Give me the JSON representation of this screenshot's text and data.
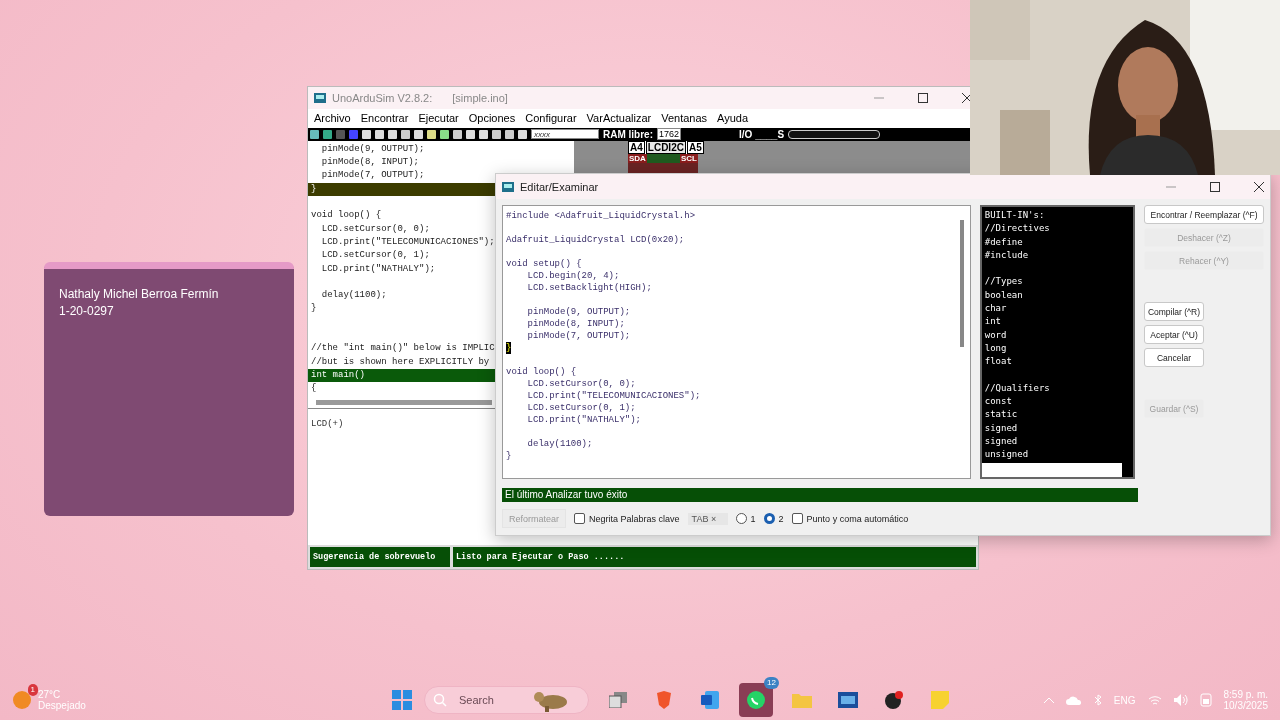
{
  "student_card": {
    "name": "Nathaly Michel Berroa Fermín",
    "id": "1-20-0297"
  },
  "main_window": {
    "app_title": "UnoArduSim V2.8.2:",
    "file": "[simple.ino]",
    "menu": [
      "Archivo",
      "Encontrar",
      "Ejecutar",
      "Opciones",
      "Configurar",
      "VarActualizar",
      "Ventanas",
      "Ayuda"
    ],
    "toolbar": {
      "search_value": "xxxx",
      "ram_label": "RAM libre:",
      "ram_value": "1762",
      "io_label": "I/O ____S"
    },
    "lcd_module": {
      "left_pin": "A4",
      "title": "LCDI2C",
      "right_pin": "A5",
      "sda": "SDA",
      "scl": "SCL"
    },
    "code_lines": [
      {
        "kind": "code",
        "text": "  pinMode(9, OUTPUT);"
      },
      {
        "kind": "code",
        "text": "  pinMode(8, INPUT);"
      },
      {
        "kind": "code",
        "text": "  pinMode(7, OUTPUT);"
      },
      {
        "kind": "current",
        "text": "}"
      },
      {
        "kind": "blank"
      },
      {
        "kind": "code",
        "text": "void loop() {"
      },
      {
        "kind": "code",
        "text": "  LCD.setCursor(0, 0);"
      },
      {
        "kind": "code",
        "text": "  LCD.print(\"TELECOMUNICACIONES\");"
      },
      {
        "kind": "code",
        "text": "  LCD.setCursor(0, 1);"
      },
      {
        "kind": "code",
        "text": "  LCD.print(\"NATHALY\");"
      },
      {
        "kind": "blank"
      },
      {
        "kind": "code",
        "text": "  delay(1100);"
      },
      {
        "kind": "code",
        "text": "}"
      },
      {
        "kind": "blank"
      },
      {
        "kind": "blank"
      },
      {
        "kind": "code",
        "text": "//the \"int main()\" below is IMPLIC"
      },
      {
        "kind": "code",
        "text": "//but is shown here EXPLICITLY by"
      },
      {
        "kind": "active",
        "text": "int main()"
      },
      {
        "kind": "code",
        "text": "{"
      }
    ],
    "lower_pane_text": "LCD(+)",
    "status": [
      "Sugerencia de sobrevuelo",
      "Listo para Ejecutar o Paso ......"
    ]
  },
  "dialog": {
    "title": "Editar/Examinar",
    "code_lines": [
      {
        "kind": "code",
        "text": "#include <Adafruit_LiquidCrystal.h>"
      },
      {
        "kind": "blank"
      },
      {
        "kind": "code",
        "text": "Adafruit_LiquidCrystal LCD(0x20);"
      },
      {
        "kind": "blank"
      },
      {
        "kind": "code",
        "text": "void setup() {"
      },
      {
        "kind": "code",
        "text": "    LCD.begin(20, 4);"
      },
      {
        "kind": "code",
        "text": "    LCD.setBacklight(HIGH);"
      },
      {
        "kind": "blank"
      },
      {
        "kind": "code",
        "text": "    pinMode(9, OUTPUT);"
      },
      {
        "kind": "code",
        "text": "    pinMode(8, INPUT);"
      },
      {
        "kind": "code",
        "text": "    pinMode(7, OUTPUT);"
      },
      {
        "kind": "cursor",
        "text": "}"
      },
      {
        "kind": "blank"
      },
      {
        "kind": "code",
        "text": "void loop() {"
      },
      {
        "kind": "code",
        "text": "    LCD.setCursor(0, 0);"
      },
      {
        "kind": "code",
        "text": "    LCD.print(\"TELECOMUNICACIONES\");"
      },
      {
        "kind": "code",
        "text": "    LCD.setCursor(0, 1);"
      },
      {
        "kind": "code",
        "text": "    LCD.print(\"NATHALY\");"
      },
      {
        "kind": "blank"
      },
      {
        "kind": "code",
        "text": "    delay(1100);"
      },
      {
        "kind": "code",
        "text": "}"
      }
    ],
    "builtins": [
      {
        "kind": "item",
        "text": "BUILT-IN's:"
      },
      {
        "kind": "item",
        "text": "//Directives"
      },
      {
        "kind": "item",
        "text": "#define"
      },
      {
        "kind": "item",
        "text": "#include"
      },
      {
        "kind": "blank"
      },
      {
        "kind": "item",
        "text": "//Types"
      },
      {
        "kind": "item",
        "text": "boolean"
      },
      {
        "kind": "item",
        "text": "char"
      },
      {
        "kind": "item",
        "text": "int"
      },
      {
        "kind": "item",
        "text": "word"
      },
      {
        "kind": "item",
        "text": "long"
      },
      {
        "kind": "item",
        "text": "float"
      },
      {
        "kind": "blank"
      },
      {
        "kind": "item",
        "text": "//Qualifiers"
      },
      {
        "kind": "item",
        "text": "const"
      },
      {
        "kind": "item",
        "text": "static"
      },
      {
        "kind": "item",
        "text": "signed"
      },
      {
        "kind": "item",
        "text": "signed"
      },
      {
        "kind": "item",
        "text": "unsigned"
      }
    ],
    "button_groups": [
      [
        {
          "label": "Encontrar / Reemplazar (^F)",
          "disabled": false
        },
        {
          "label": "Deshacer (^Z)",
          "disabled": true
        },
        {
          "label": "Rehacer (^Y)",
          "disabled": true
        }
      ],
      [
        {
          "label": "Compilar (^R)",
          "disabled": false
        },
        {
          "label": "Aceptar (^U)",
          "disabled": false
        },
        {
          "label": "Cancelar",
          "disabled": false
        }
      ],
      [
        {
          "label": "Guardar (^S)",
          "disabled": true
        }
      ]
    ],
    "status": "El último Analizar tuvo éxito",
    "reformat": {
      "label": "Reformatear",
      "disabled": true
    },
    "bold_keywords": {
      "label": "Negrita Palabras clave",
      "checked": false
    },
    "tab_field": "TAB ×",
    "radios": [
      {
        "label": "1",
        "selected": false
      },
      {
        "label": "2",
        "selected": true
      }
    ],
    "auto_semicolon": {
      "label": "Punto y coma automático",
      "checked": false
    }
  },
  "taskbar": {
    "weather_badge": "1",
    "temperature": "27°C",
    "condition": "Despejado",
    "search_placeholder": "Search",
    "chat_badge": "12",
    "language": "ENG",
    "time": "8:59 p. m.",
    "date": "10/3/2025"
  }
}
